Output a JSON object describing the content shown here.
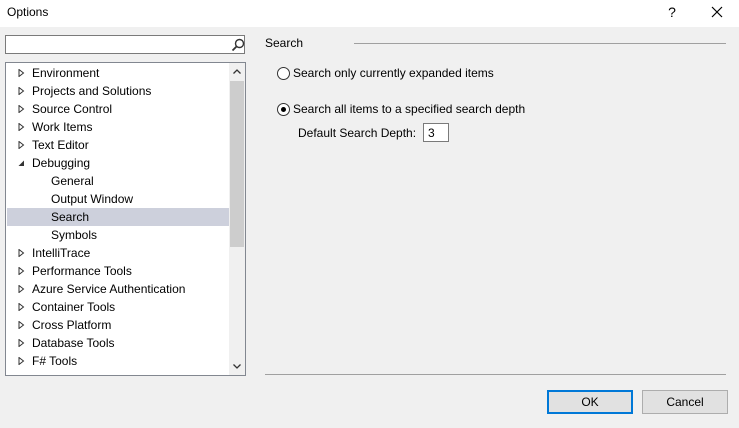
{
  "window": {
    "title": "Options",
    "help_glyph": "?"
  },
  "search": {
    "value": "",
    "placeholder": ""
  },
  "tree": {
    "items": [
      {
        "label": "Environment",
        "level": 0,
        "expander": "collapsed"
      },
      {
        "label": "Projects and Solutions",
        "level": 0,
        "expander": "collapsed"
      },
      {
        "label": "Source Control",
        "level": 0,
        "expander": "collapsed"
      },
      {
        "label": "Work Items",
        "level": 0,
        "expander": "collapsed"
      },
      {
        "label": "Text Editor",
        "level": 0,
        "expander": "collapsed"
      },
      {
        "label": "Debugging",
        "level": 0,
        "expander": "expanded"
      },
      {
        "label": "General",
        "level": 1,
        "expander": "none"
      },
      {
        "label": "Output Window",
        "level": 1,
        "expander": "none"
      },
      {
        "label": "Search",
        "level": 1,
        "expander": "none",
        "selected": true
      },
      {
        "label": "Symbols",
        "level": 1,
        "expander": "none"
      },
      {
        "label": "IntelliTrace",
        "level": 0,
        "expander": "collapsed"
      },
      {
        "label": "Performance Tools",
        "level": 0,
        "expander": "collapsed"
      },
      {
        "label": "Azure Service Authentication",
        "level": 0,
        "expander": "collapsed"
      },
      {
        "label": "Container Tools",
        "level": 0,
        "expander": "collapsed"
      },
      {
        "label": "Cross Platform",
        "level": 0,
        "expander": "collapsed"
      },
      {
        "label": "Database Tools",
        "level": 0,
        "expander": "collapsed"
      },
      {
        "label": "F# Tools",
        "level": 0,
        "expander": "collapsed"
      }
    ],
    "selection_color": "#cdd0dc"
  },
  "panel": {
    "section_title": "Search",
    "option_expanded": "Search only currently expanded items",
    "option_depth": "Search all items to a specified search depth",
    "selected_option": "option_depth",
    "depth_label": "Default Search Depth:",
    "depth_value": "3"
  },
  "buttons": {
    "ok": "OK",
    "cancel": "Cancel",
    "accent": "#0078d7"
  }
}
